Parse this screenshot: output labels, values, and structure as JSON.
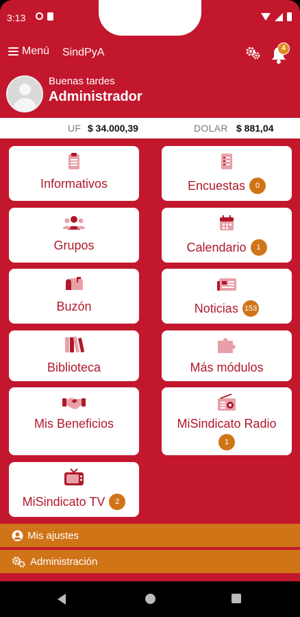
{
  "status_bar": {
    "time": "3:13"
  },
  "header": {
    "menu_label": "Menú",
    "app_name": "SindPyA",
    "notification_count": "4"
  },
  "user": {
    "greeting": "Buenas tardes",
    "name": "Administrador"
  },
  "currency": {
    "uf_label": "UF",
    "uf_value": "$ 34.000,39",
    "dolar_label": "DOLAR",
    "dolar_value": "$ 881,04"
  },
  "tiles": {
    "informativos": {
      "label": "Informativos",
      "icon": "clipboard-icon"
    },
    "encuestas": {
      "label": "Encuestas",
      "count": "0",
      "icon": "list-icon"
    },
    "grupos": {
      "label": "Grupos",
      "icon": "users-icon"
    },
    "calendario": {
      "label": "Calendario",
      "count": "1",
      "icon": "calendar-icon"
    },
    "buzon": {
      "label": "Buzón",
      "icon": "mailbox-icon"
    },
    "noticias": {
      "label": "Noticias",
      "count": "153",
      "icon": "newspaper-icon"
    },
    "biblioteca": {
      "label": "Biblioteca",
      "icon": "books-icon"
    },
    "mas_modulos": {
      "label": "Más módulos",
      "icon": "puzzle-icon"
    },
    "beneficios": {
      "label": "Mis Beneficios",
      "icon": "handshake-icon"
    },
    "radio": {
      "label": "MiSindicato Radio",
      "count": "1",
      "icon": "radio-icon"
    },
    "tv": {
      "label": "MiSindicato TV",
      "count": "2",
      "icon": "tv-icon"
    }
  },
  "bottom": {
    "ajustes": "Mis ajustes",
    "administracion": "Administración"
  },
  "colors": {
    "primary": "#c3172d",
    "accent": "#d07418",
    "tile_icon": "#e8a0a8"
  }
}
